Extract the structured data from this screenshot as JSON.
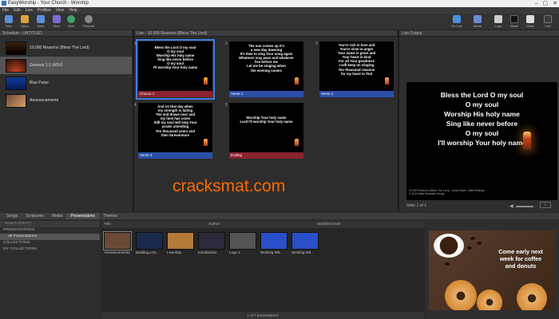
{
  "window": {
    "title": "EasyWorship - Your Church - Worship",
    "controls": [
      "–",
      "▢",
      "✕"
    ]
  },
  "menu": [
    "File",
    "Edit",
    "Live",
    "Profiles",
    "View",
    "Help"
  ],
  "toolbar": {
    "left": [
      {
        "label": "New",
        "icon": "new-icon",
        "color": "#5a8fd6"
      },
      {
        "label": "Open",
        "icon": "open-icon",
        "color": "#d9a43a"
      },
      {
        "label": "Save",
        "icon": "save-icon",
        "color": "#5a8fd6"
      },
      {
        "label": "Store",
        "icon": "store-icon",
        "color": "#7b6bd6"
      },
      {
        "label": "Web",
        "icon": "web-icon",
        "color": "#3fa36b"
      },
      {
        "label": "Remote",
        "icon": "remote-icon",
        "color": "#888888"
      }
    ],
    "right": [
      {
        "label": "Go Live",
        "icon": "go-live-icon",
        "color": "#4a90e2"
      },
      {
        "label": "Alerts",
        "icon": "alerts-icon",
        "color": "#6b8bd6"
      },
      {
        "label": "Logo",
        "icon": "logo-icon",
        "color": "#cccccc"
      },
      {
        "label": "Black",
        "icon": "black-icon",
        "color": "#111111"
      },
      {
        "label": "Clear",
        "icon": "clear-icon",
        "color": "#dddddd"
      },
      {
        "label": "Live",
        "icon": "live-icon",
        "color": "#3a3a3a"
      }
    ]
  },
  "schedule": {
    "header": "Schedule - UNTITLED",
    "items": [
      {
        "label": "10,000 Reasons (Bless The Lord)",
        "active": false
      },
      {
        "label": "Genesis 1:1 (ASV)",
        "active": true
      },
      {
        "label": "Blue Pulse",
        "active": false
      },
      {
        "label": "Announcements",
        "active": false
      }
    ]
  },
  "live": {
    "header": "Live - 10,000 Reasons (Bless The Lord)",
    "slides": [
      {
        "num": "1",
        "lines": [
          "Bless the Lord O my soul",
          "O my soul",
          "Worship His holy name",
          "Sing like never before",
          "O my soul",
          "I'll worship Your holy name"
        ],
        "tag": "Chorus 1",
        "tag_color": "#8a2230",
        "selected": true
      },
      {
        "num": "2",
        "lines": [
          "The sun comes up it's",
          "a new day dawning",
          "It's time to sing Your song again",
          "Whatever may pass and whatever",
          "lies before me",
          "Let me be singing when",
          "the evening comes"
        ],
        "tag": "Verse 1",
        "tag_color": "#2b4fa8",
        "selected": false
      },
      {
        "num": "3",
        "lines": [
          "You're rich in love and",
          "You're slow to anger",
          "Your name is great and",
          "Your heart is kind",
          "For all Your goodness",
          "I will keep on singing",
          "Ten thousand reasons",
          "for my heart to find"
        ],
        "tag": "Verse 2",
        "tag_color": "#2b4fa8",
        "selected": false
      },
      {
        "num": "4",
        "lines": [
          "And on that day when",
          "my strength is failing",
          "The end draws near and",
          "my time has come",
          "Still my soul will sing Your",
          "praise unending",
          "Ten thousand years and",
          "then forevermore"
        ],
        "tag": "Verse 3",
        "tag_color": "#2b4fa8",
        "selected": false
      },
      {
        "num": "5",
        "lines": [
          "Worship Your holy name",
          "Lord I'll worship Your holy name"
        ],
        "tag": "Ending",
        "tag_color": "#8a2230",
        "selected": false
      }
    ]
  },
  "output": {
    "header": "Live Output",
    "lyrics": [
      "Bless the Lord O my soul",
      "O my soul",
      "Worship His holy name",
      "Sing like never before",
      "O my soul",
      "I'll worship Your holy name"
    ],
    "credit": [
      "10,000 Reasons (Bless The Lord) - Jonas Myrin | Matt Redman",
      "© 2011 Atlas Mountain Songs"
    ],
    "footer": "Slide 1 of 1"
  },
  "watermark": "cracksmat.com",
  "bottom_tabs": [
    {
      "label": "Songs",
      "active": false
    },
    {
      "label": "Scriptures",
      "active": false
    },
    {
      "label": "Media",
      "active": false
    },
    {
      "label": "Presentations",
      "active": true
    },
    {
      "label": "Themes",
      "active": false
    }
  ],
  "tree": {
    "search_placeholder": "Search (Ctrl+F)",
    "rows": [
      {
        "label": "PRESENTATIONS",
        "sub": false
      },
      {
        "label": "All Presentations",
        "sub": true
      },
      {
        "label": "COLLECTIONS",
        "sub": false
      },
      {
        "label": "MY COLLECTIONS",
        "sub": false
      }
    ]
  },
  "presentations": {
    "columns": [
      "Title",
      "Author",
      "Modified Date"
    ],
    "items": [
      {
        "label": "Announcements",
        "color": "#6b4a35",
        "selected": true
      },
      {
        "label": "Building a M...",
        "color": "#1a2a4a",
        "selected": false
      },
      {
        "label": "I worship",
        "color": "#b47a3a",
        "selected": false
      },
      {
        "label": "Introduction",
        "color": "#2a2a3a",
        "selected": false
      },
      {
        "label": "Logo 1",
        "color": "#555555",
        "selected": false
      },
      {
        "label": "Working Wit...",
        "color": "#2b4fc8",
        "selected": false
      },
      {
        "label": "Working Wit...",
        "color": "#2b4fc8",
        "selected": false
      }
    ],
    "footer": "1 of 7 presentations"
  },
  "preview": {
    "ad_text": [
      "Come early next",
      "week for coffee",
      "and donuts"
    ]
  }
}
